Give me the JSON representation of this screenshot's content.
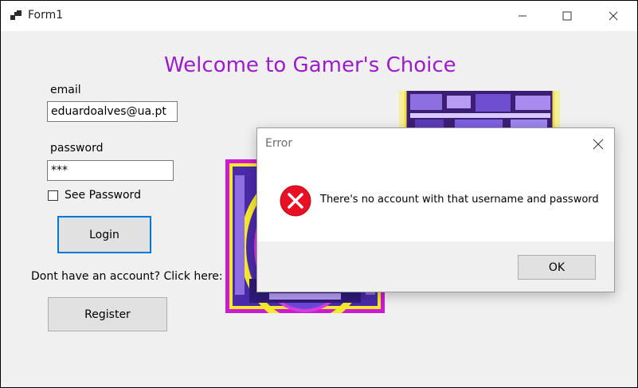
{
  "window": {
    "title": "Form1"
  },
  "form": {
    "heading": "Welcome to Gamer's Choice",
    "email_label": "email",
    "email_value": "eduardoalves@ua.pt",
    "password_label": "password",
    "password_value": "***",
    "see_password_label": "See Password",
    "see_password_checked": false,
    "login_label": "Login",
    "register_prompt": "Dont have an account? Click here:",
    "register_label": "Register"
  },
  "dialog": {
    "title": "Error",
    "message": "There's no account with that username and password",
    "ok_label": "OK",
    "icon": "error-icon"
  },
  "colors": {
    "accent": "#9d1cc9",
    "focus": "#0078d7",
    "error": "#e81123"
  }
}
